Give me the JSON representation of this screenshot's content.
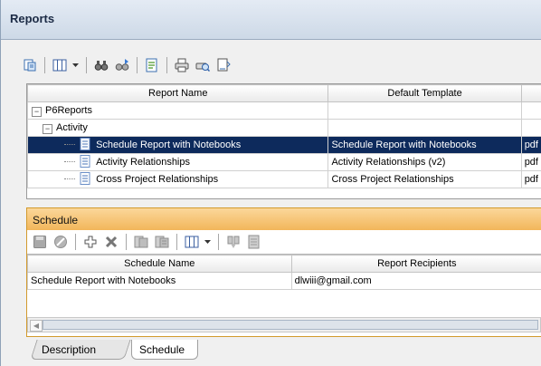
{
  "panel": {
    "title": "Reports"
  },
  "toolbar": {
    "icons": [
      "reports-tree-icon",
      "columns-icon",
      "find-icon",
      "find-next-icon",
      "run-report-icon",
      "print-icon",
      "print-preview-icon",
      "page-setup-icon"
    ]
  },
  "reports_grid": {
    "columns": [
      "Report Name",
      "Default Template",
      ""
    ],
    "rows": [
      {
        "name": "P6Reports",
        "template": "",
        "format": "",
        "level": 0,
        "type": "folder"
      },
      {
        "name": "Activity",
        "template": "",
        "format": "",
        "level": 1,
        "type": "folder"
      },
      {
        "name": "Schedule Report with Notebooks",
        "template": "Schedule Report with Notebooks",
        "format": "pdf",
        "level": 2,
        "type": "report",
        "selected": true
      },
      {
        "name": "Activity Relationships",
        "template": "Activity Relationships (v2)",
        "format": "pdf",
        "level": 2,
        "type": "report"
      },
      {
        "name": "Cross Project Relationships",
        "template": "Cross Project Relationships",
        "format": "pdf",
        "level": 2,
        "type": "report"
      }
    ]
  },
  "schedule": {
    "title": "Schedule",
    "columns": [
      "Schedule Name",
      "Report Recipients"
    ],
    "rows": [
      {
        "name": "Schedule Report with Notebooks",
        "recipients": "dlwiii@gmail.com"
      }
    ]
  },
  "tabs": [
    {
      "label": "Description",
      "active": false
    },
    {
      "label": "Schedule",
      "active": true
    }
  ],
  "colors": {
    "selection": "#0d2a5c",
    "schedule_header": "#f2b65a",
    "title_bar": "#cdd9e7"
  }
}
